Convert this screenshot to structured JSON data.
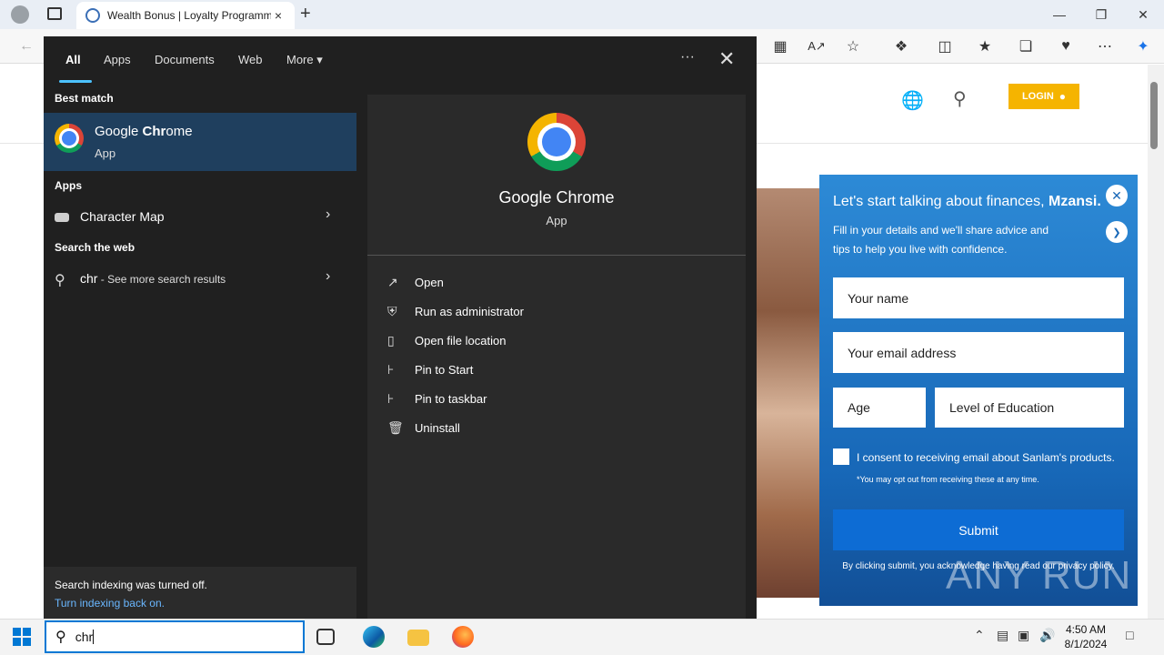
{
  "browser": {
    "tab_title": "Wealth Bonus | Loyalty Programme",
    "tab_close": "×",
    "new_tab": "+"
  },
  "page": {
    "login_label": "LOGIN",
    "form": {
      "title_text": "Let's start talking about finances,",
      "title_bold": "Mzansi.",
      "subtitle": "Fill in your details and we'll share advice and tips to help you live with confidence.",
      "name_placeholder": "Your name",
      "email_placeholder": "Your email address",
      "age_placeholder": "Age",
      "education_placeholder": "Level of Education",
      "consent": "I consent to receiving email about Sanlam's products.",
      "optout": "*You may opt out from receiving these at any time.",
      "submit_label": "Submit",
      "footer": "By clicking submit, you acknowledge having read our privacy policy."
    },
    "watermark": "ANY RUN"
  },
  "search_flyout": {
    "tabs": [
      "All",
      "Apps",
      "Documents",
      "Web",
      "More"
    ],
    "more_arrow": "▾",
    "dots": "···",
    "close": "✕",
    "best_match_label": "Best match",
    "best_match": {
      "name_prefix": "Google ",
      "name_bold": "Chr",
      "name_suffix": "ome",
      "type": "App"
    },
    "apps_label": "Apps",
    "apps": [
      {
        "name": "Character Map"
      }
    ],
    "web_label": "Search the web",
    "web_query": "chr",
    "web_more": " - See more search results",
    "chevron": "›",
    "indexing_text": "Search indexing was turned off.",
    "indexing_link": "Turn indexing back on.",
    "preview": {
      "name": "Google Chrome",
      "type": "App",
      "actions": [
        "Open",
        "Run as administrator",
        "Open file location",
        "Pin to Start",
        "Pin to taskbar",
        "Uninstall"
      ]
    }
  },
  "taskbar": {
    "search_value": "chr",
    "time": "4:50 AM",
    "date": "8/1/2024"
  }
}
